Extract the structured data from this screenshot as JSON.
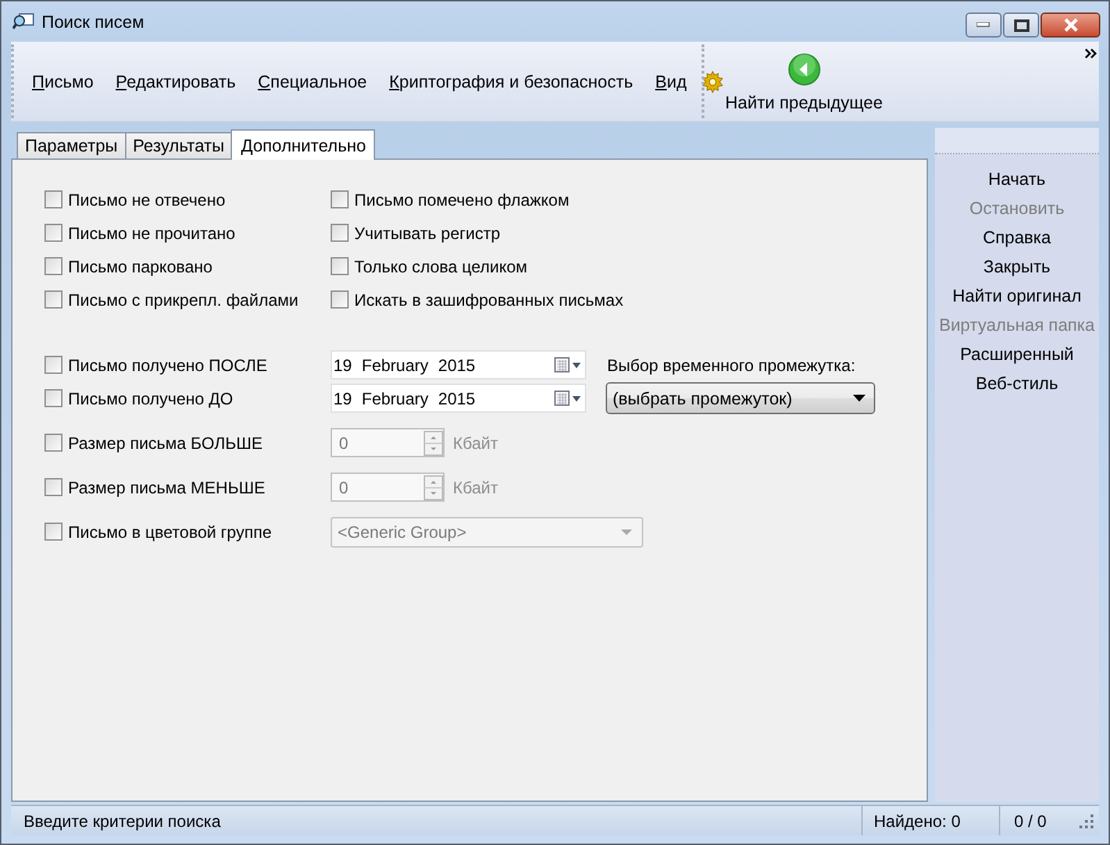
{
  "window": {
    "title": "Поиск писем"
  },
  "menu": [
    {
      "label": "Письмо"
    },
    {
      "label": "Редактировать"
    },
    {
      "label": "Специальное"
    },
    {
      "label": "Криптография и безопасность"
    },
    {
      "label": "Вид"
    }
  ],
  "toolbar_button": {
    "label": "Найти предыдущее"
  },
  "tabs": [
    {
      "label": "Параметры",
      "selected": false
    },
    {
      "label": "Результаты",
      "selected": false
    },
    {
      "label": "Дополнительно",
      "selected": true
    }
  ],
  "flags_left": [
    {
      "label": "Письмо не отвечено",
      "checked": false
    },
    {
      "label": "Письмо не прочитано",
      "checked": false
    },
    {
      "label": "Письмо парковано",
      "checked": false
    },
    {
      "label": "Письмо с прикрепл. файлами",
      "checked": false
    }
  ],
  "flags_right": [
    {
      "label": "Письмо помечено флажком",
      "checked": false
    },
    {
      "label": "Учитывать регистр",
      "checked": false
    },
    {
      "label": "Только слова целиком",
      "checked": false
    },
    {
      "label": "Искать в зашифрованных письмах",
      "checked": false
    }
  ],
  "dates": [
    {
      "label": "Письмо получено ПОСЛЕ",
      "checked": false,
      "day": "19",
      "month": "February",
      "year": "2015"
    },
    {
      "label": "Письмо получено ДО",
      "checked": false,
      "day": "19",
      "month": "February",
      "year": "2015"
    }
  ],
  "period": {
    "label": "Выбор временного промежутка:",
    "value": "(выбрать промежуток)"
  },
  "sizes": [
    {
      "label": "Размер письма БОЛЬШЕ",
      "checked": false,
      "value": "0",
      "unit": "Кбайт",
      "disabled": true
    },
    {
      "label": "Размер письма МЕНЬШЕ",
      "checked": false,
      "value": "0",
      "unit": "Кбайт",
      "disabled": true
    }
  ],
  "color_group": {
    "label": "Письмо в цветовой группе",
    "checked": false,
    "value": "<Generic Group>",
    "disabled": true
  },
  "actions": [
    {
      "label": "Начать",
      "disabled": false
    },
    {
      "label": "Остановить",
      "disabled": true
    },
    {
      "label": "Справка",
      "disabled": false
    },
    {
      "label": "Закрыть",
      "disabled": false
    },
    {
      "label": "Найти оригинал",
      "disabled": false
    },
    {
      "label": "Виртуальная папка",
      "disabled": true
    },
    {
      "label": "Расширенный",
      "disabled": false
    },
    {
      "label": "Веб-стиль",
      "disabled": false
    }
  ],
  "status_bar": {
    "message": "Введите критерии поиска",
    "found": "Найдено: 0",
    "count": "0 / 0"
  }
}
